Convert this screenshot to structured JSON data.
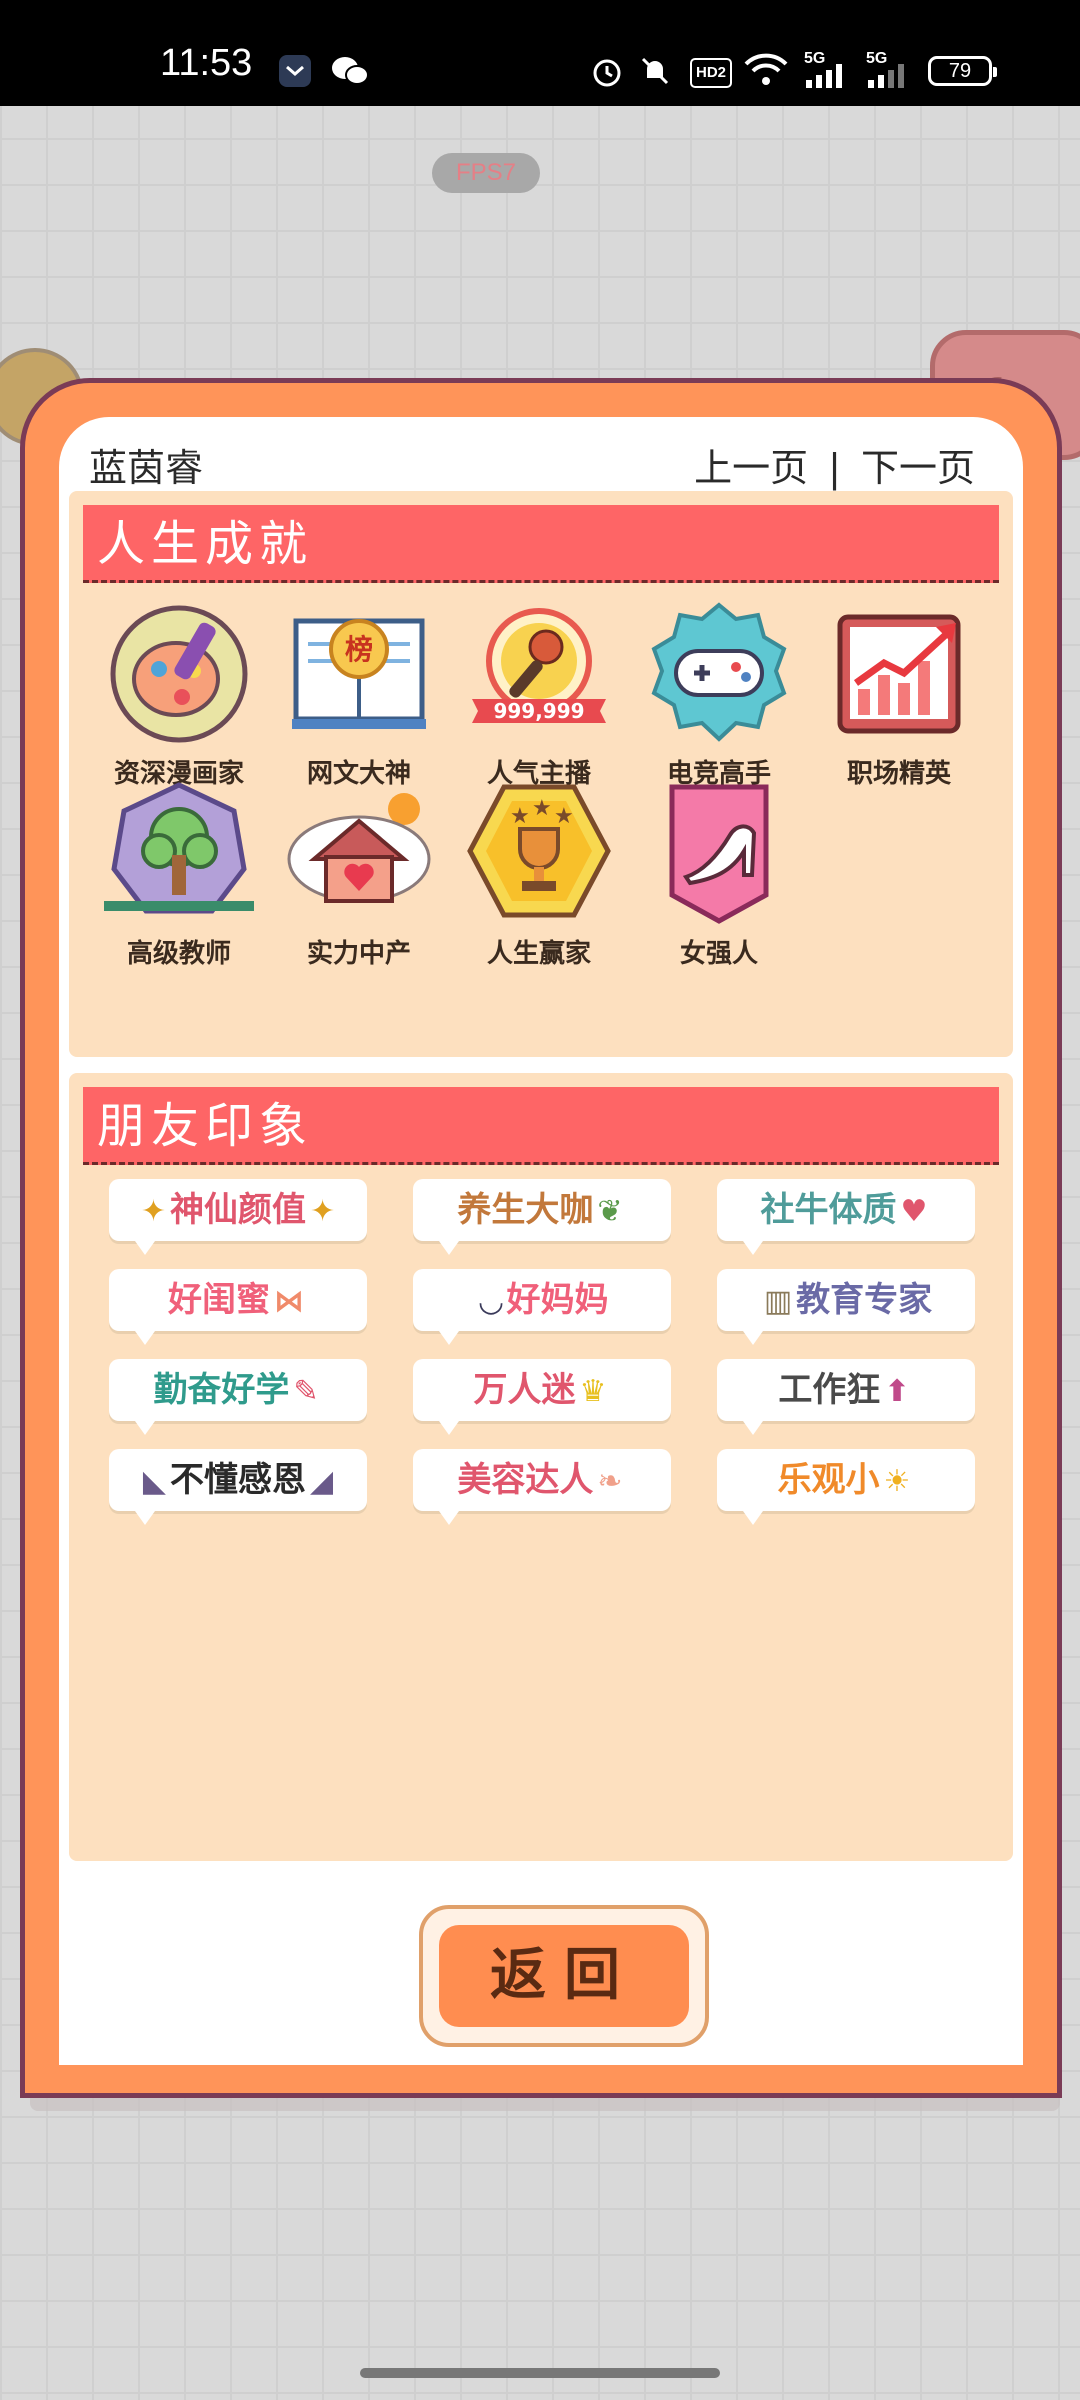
{
  "status_bar": {
    "time": "11:53",
    "battery": "79",
    "signal_1": "5G",
    "signal_2": "5G",
    "hd_label": "HD2"
  },
  "game": {
    "fps": "FPS7"
  },
  "dialog": {
    "player_name": "蓝茵睿",
    "prev_page": "上一页",
    "separator": "|",
    "next_page": "下一页",
    "back_button": "返回"
  },
  "achievements": {
    "title": "人生成就",
    "items": [
      {
        "label": "资深漫画家",
        "icon": "palette-icon"
      },
      {
        "label": "网文大神",
        "icon": "book-rank-icon"
      },
      {
        "label": "人气主播",
        "icon": "microphone-icon",
        "badge_text": "999,999"
      },
      {
        "label": "电竞高手",
        "icon": "gamepad-icon"
      },
      {
        "label": "职场精英",
        "icon": "growth-chart-icon"
      },
      {
        "label": "高级教师",
        "icon": "tree-book-icon"
      },
      {
        "label": "实力中产",
        "icon": "house-heart-icon"
      },
      {
        "label": "人生赢家",
        "icon": "trophy-icon"
      },
      {
        "label": "女强人",
        "icon": "high-heel-icon"
      }
    ],
    "rank_char": "榜"
  },
  "impressions": {
    "title": "朋友印象",
    "tags": [
      {
        "label": "神仙颜值",
        "color": "#e0566d"
      },
      {
        "label": "养生大咖",
        "color": "#c2783b"
      },
      {
        "label": "社牛体质",
        "color": "#4f9c9a"
      },
      {
        "label": "好闺蜜",
        "color": "#f0607a"
      },
      {
        "label": "好妈妈",
        "color": "#f0607a"
      },
      {
        "label": "教育专家",
        "color": "#6a6aa6"
      },
      {
        "label": "勤奋好学",
        "color": "#2f9b8c"
      },
      {
        "label": "万人迷",
        "color": "#e0566d"
      },
      {
        "label": "工作狂",
        "color": "#4a4a4a"
      },
      {
        "label": "不懂感恩",
        "color": "#2a2a2a"
      },
      {
        "label": "美容达人",
        "color": "#e0566d"
      },
      {
        "label": "乐观小",
        "color": "#f08a2a"
      }
    ]
  },
  "colors": {
    "dialog_frame": "#ff9459",
    "panel_bg": "#fde0bf",
    "header_red": "#fe6566",
    "button_orange": "#ff8d50"
  }
}
